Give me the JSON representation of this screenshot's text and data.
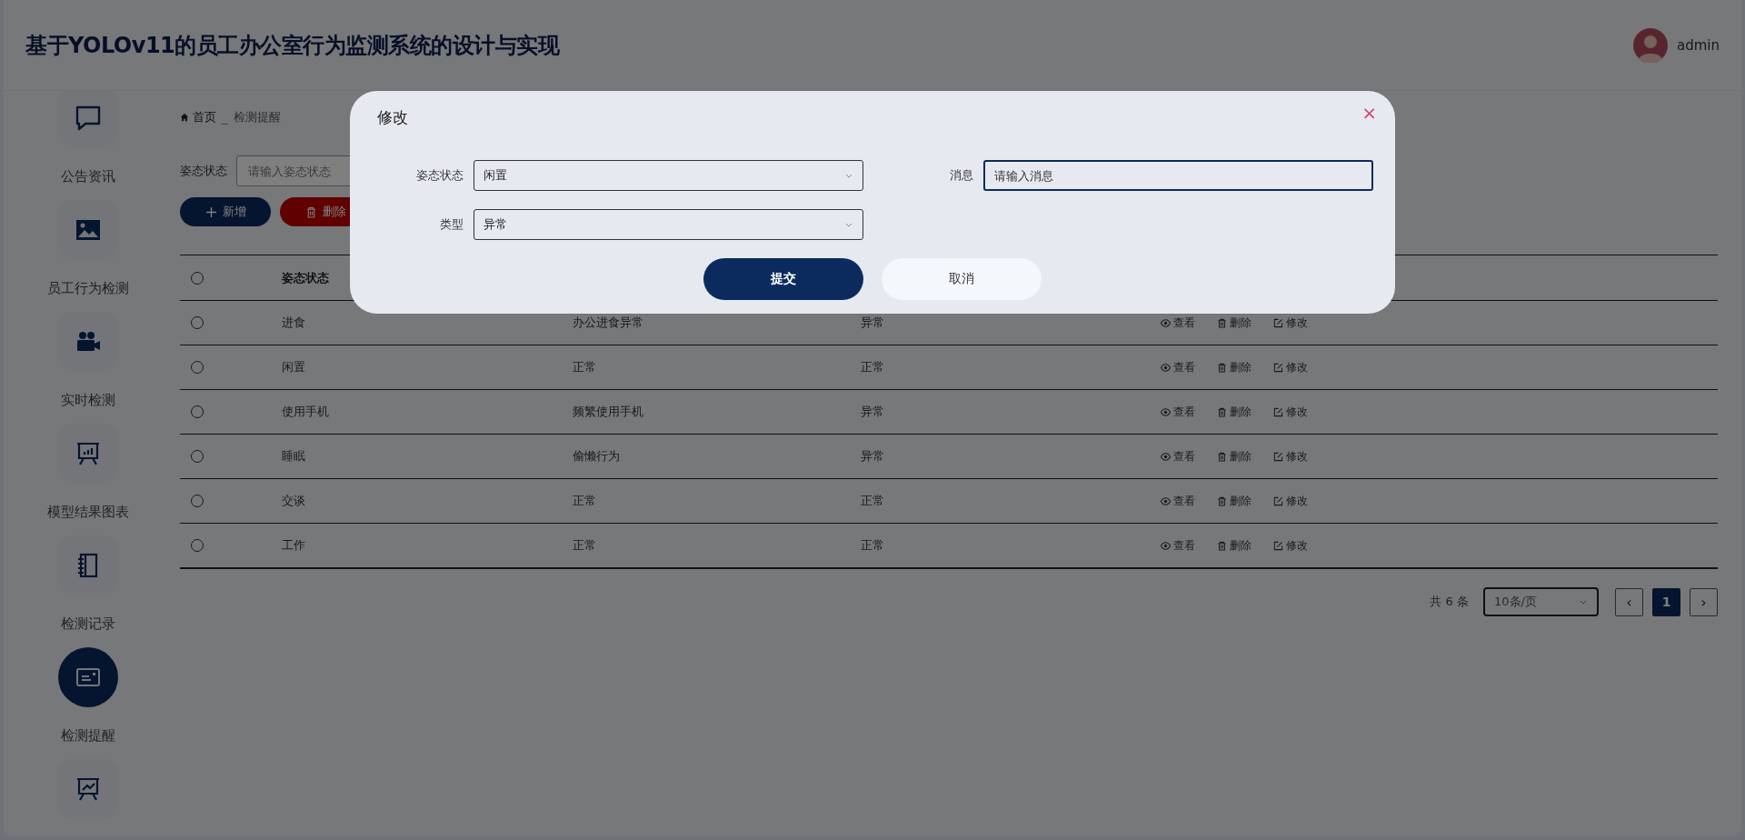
{
  "header": {
    "title": "基于YOLOv11的员工办公室行为监测系统的设计与实现",
    "user": "admin"
  },
  "sidebar": {
    "items": [
      {
        "label": "公告资讯",
        "selected": false
      },
      {
        "label": "员工行为检测",
        "selected": false
      },
      {
        "label": "实时检测",
        "selected": false
      },
      {
        "label": "模型结果图表",
        "selected": false
      },
      {
        "label": "检测记录",
        "selected": false
      },
      {
        "label": "检测提醒",
        "selected": true
      },
      {
        "selected": false
      }
    ]
  },
  "breadcrumb": {
    "items": [
      "首页",
      "检测提醒"
    ],
    "separator": "_"
  },
  "search": {
    "label": "姿态状态",
    "placeholder": "请输入姿态状态"
  },
  "toolbar": [
    {
      "label": "新增",
      "kind": "add"
    },
    {
      "label": "删除",
      "kind": "delete"
    }
  ],
  "table": {
    "columns": [
      "姿态状态"
    ],
    "header_selected": false,
    "rows": [
      {
        "selected": false,
        "cells": [
          "进食",
          "办公进食异常",
          "异常"
        ],
        "actions": [
          {
            "label": "查看",
            "kind": "view"
          },
          {
            "label": "删除",
            "kind": "delete"
          },
          {
            "label": "修改",
            "kind": "edit"
          }
        ]
      },
      {
        "selected": false,
        "cells": [
          "闲置",
          "正常",
          "正常"
        ],
        "actions": [
          {
            "label": "查看",
            "kind": "view"
          },
          {
            "label": "删除",
            "kind": "delete"
          },
          {
            "label": "修改",
            "kind": "edit"
          }
        ]
      },
      {
        "selected": false,
        "cells": [
          "使用手机",
          "频繁使用手机",
          "异常"
        ],
        "actions": [
          {
            "label": "查看",
            "kind": "view"
          },
          {
            "label": "删除",
            "kind": "delete"
          },
          {
            "label": "修改",
            "kind": "edit"
          }
        ]
      },
      {
        "selected": false,
        "cells": [
          "睡眠",
          "偷懒行为",
          "异常"
        ],
        "actions": [
          {
            "label": "查看",
            "kind": "view"
          },
          {
            "label": "删除",
            "kind": "delete"
          },
          {
            "label": "修改",
            "kind": "edit"
          }
        ]
      },
      {
        "selected": false,
        "cells": [
          "交谈",
          "正常",
          "正常"
        ],
        "actions": [
          {
            "label": "查看",
            "kind": "view"
          },
          {
            "label": "删除",
            "kind": "delete"
          },
          {
            "label": "修改",
            "kind": "edit"
          }
        ]
      },
      {
        "selected": false,
        "cells": [
          "工作",
          "正常",
          "正常"
        ],
        "actions": [
          {
            "label": "查看",
            "kind": "view"
          },
          {
            "label": "删除",
            "kind": "delete"
          },
          {
            "label": "修改",
            "kind": "edit"
          }
        ]
      }
    ]
  },
  "pagination": {
    "total": "共 6 条",
    "page_size": "10条/页",
    "prev": "‹",
    "next": "›",
    "pages": [
      {
        "label": "1",
        "selected": true
      }
    ]
  },
  "dialog": {
    "title": "修改",
    "close": "×",
    "fields": [
      {
        "label": "姿态状态",
        "kind": "select",
        "value": "闲置"
      },
      {
        "label": "消息",
        "kind": "input",
        "placeholder": "请输入消息",
        "focused": true
      },
      {
        "label": "类型",
        "kind": "select",
        "value": "异常"
      }
    ],
    "buttons": [
      {
        "label": "提交",
        "kind": "primary"
      },
      {
        "label": "取消",
        "kind": "secondary"
      }
    ]
  }
}
